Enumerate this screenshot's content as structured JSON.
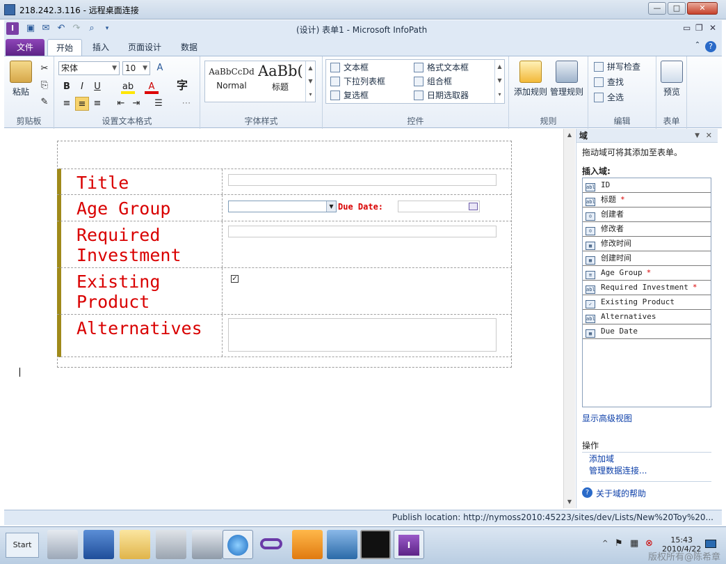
{
  "rdp": {
    "title": "218.242.3.116 - 远程桌面连接"
  },
  "app": {
    "title": "(设计) 表单1 - Microsoft InfoPath"
  },
  "ribbon_tabs": [
    "文件",
    "开始",
    "插入",
    "页面设计",
    "数据"
  ],
  "ribbon": {
    "clipboard": {
      "paste": "粘贴",
      "label": "剪贴板"
    },
    "font": {
      "name": "宋体",
      "size": "10",
      "label": "设置文本格式"
    },
    "styles": {
      "normal_sample": "AaBbCcDd",
      "normal_name": "Normal",
      "title_sample": "AaBb(",
      "title_name": "标题",
      "label": "字体样式"
    },
    "controls": {
      "items": [
        "文本框",
        "格式文本框",
        "下拉列表框",
        "组合框",
        "复选框",
        "日期选取器"
      ],
      "label": "控件"
    },
    "rules": {
      "add": "添加规则",
      "manage": "管理规则",
      "label": "规则"
    },
    "editing": {
      "spell": "拼写检查",
      "find": "查找",
      "select_all": "全选",
      "label": "编辑"
    },
    "form": {
      "preview": "预览",
      "label": "表单"
    }
  },
  "form": {
    "rows": [
      {
        "label": "Title"
      },
      {
        "label": "Age Group",
        "due_label": "Due Date:"
      },
      {
        "label": "Required Investment"
      },
      {
        "label": "Existing Product"
      },
      {
        "label": "Alternatives"
      }
    ]
  },
  "pane": {
    "title": "域",
    "hint": "拖动域可将其添加至表单。",
    "insert_label": "插入域:",
    "fields": [
      {
        "name": "ID",
        "required": false,
        "icon": "text-field-icon"
      },
      {
        "name": "标题",
        "required": true,
        "icon": "text-field-icon"
      },
      {
        "name": "创建者",
        "required": false,
        "icon": "person-field-icon"
      },
      {
        "name": "修改者",
        "required": false,
        "icon": "person-field-icon"
      },
      {
        "name": "修改时间",
        "required": false,
        "icon": "date-field-icon"
      },
      {
        "name": "创建时间",
        "required": false,
        "icon": "date-field-icon"
      },
      {
        "name": "Age Group",
        "required": true,
        "icon": "choice-field-icon"
      },
      {
        "name": "Required Investment",
        "required": true,
        "icon": "text-field-icon"
      },
      {
        "name": "Existing Product",
        "required": false,
        "icon": "checkbox-field-icon"
      },
      {
        "name": "Alternatives",
        "required": false,
        "icon": "text-field-icon"
      },
      {
        "name": "Due Date",
        "required": false,
        "icon": "date-field-icon"
      }
    ],
    "required_mark": "*",
    "advanced_view": "显示高级视图",
    "actions_label": "操作",
    "add_field": "添加域",
    "manage_connections": "管理数据连接...",
    "help": "关于域的帮助"
  },
  "status": {
    "publish": "Publish location: http://nymoss2010:45223/sites/dev/Lists/New%20Toy%20..."
  },
  "taskbar": {
    "start": "Start",
    "time": "15:43",
    "date": "2010/4/22"
  },
  "watermark": "版权所有@陈希章"
}
